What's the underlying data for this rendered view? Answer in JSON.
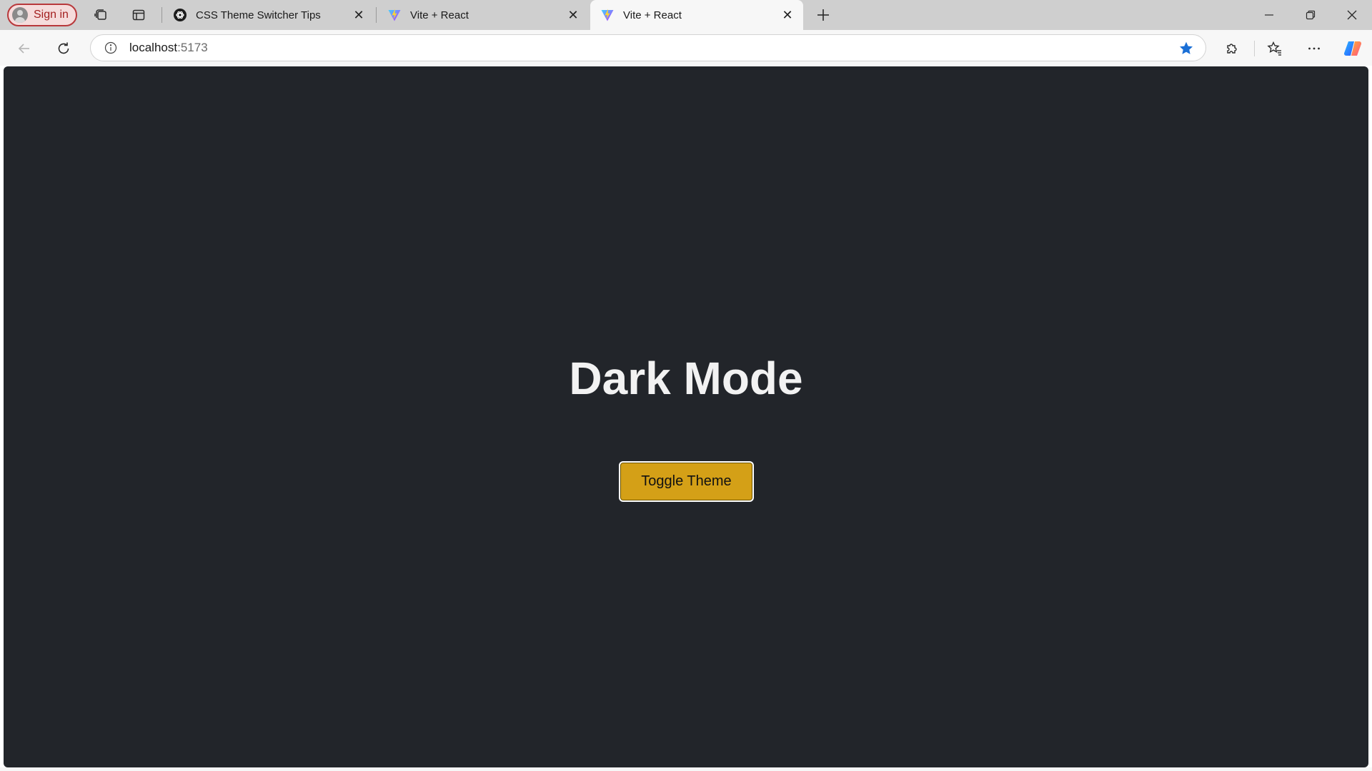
{
  "browser": {
    "sign_in_label": "Sign in",
    "tabs": [
      {
        "title": "CSS Theme Switcher Tips",
        "favicon": "openai-icon",
        "active": false
      },
      {
        "title": "Vite + React",
        "favicon": "vite-icon",
        "active": false
      },
      {
        "title": "Vite + React",
        "favicon": "vite-icon",
        "active": true
      }
    ],
    "address": {
      "host": "localhost",
      "port": ":5173"
    },
    "favorite_star_color": "#1a6fd6"
  },
  "page": {
    "background": "#22252a",
    "heading": "Dark Mode",
    "toggle_button_label": "Toggle Theme",
    "toggle_button_color": "#d4a017"
  }
}
